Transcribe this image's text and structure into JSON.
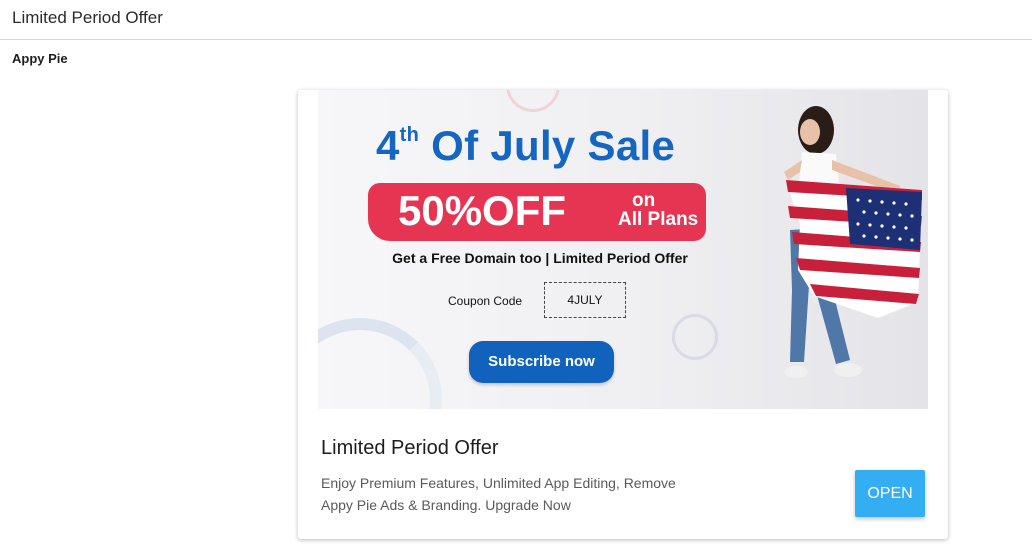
{
  "header": {
    "title": "Limited Period Offer"
  },
  "sender": {
    "name": "Appy Pie"
  },
  "banner": {
    "title_ordinal": "4",
    "title_superscript": "th",
    "title_rest": " Of July Sale",
    "discount": "50%OFF",
    "discount_on": "on",
    "discount_scope": "All Plans",
    "free_domain_line": "Get a Free Domain too | Limited Period Offer",
    "coupon_label": "Coupon Code",
    "coupon_code": "4JULY",
    "subscribe_label": "Subscribe now",
    "colors": {
      "title_blue": "#1466c0",
      "offer_red": "#e63552",
      "button_blue": "#1162bd"
    }
  },
  "card": {
    "title": "Limited Period Offer",
    "description": "Enjoy Premium Features, Unlimited App Editing, Remove Appy Pie Ads & Branding. Upgrade Now",
    "open_label": "OPEN",
    "open_color": "#34aef2"
  }
}
